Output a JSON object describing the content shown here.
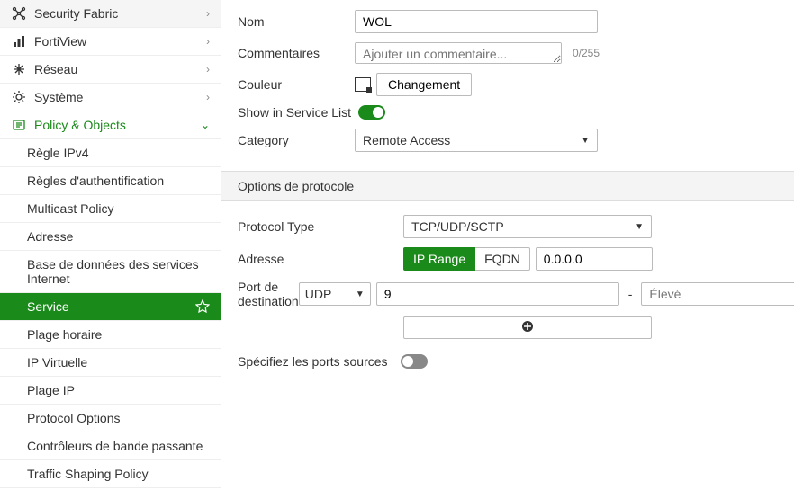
{
  "sidebar": {
    "items": [
      {
        "label": "Security Fabric",
        "icon": "fabric",
        "expanded": false
      },
      {
        "label": "FortiView",
        "icon": "chart",
        "expanded": false
      },
      {
        "label": "Réseau",
        "icon": "network",
        "expanded": false
      },
      {
        "label": "Système",
        "icon": "gear",
        "expanded": false
      },
      {
        "label": "Policy & Objects",
        "icon": "policy",
        "expanded": true,
        "active": true
      }
    ],
    "sub_items": [
      "Règle IPv4",
      "Règles d'authentification",
      "Multicast Policy",
      "Adresse",
      "Base de données des services Internet",
      "Service",
      "Plage horaire",
      "IP Virtuelle",
      "Plage IP",
      "Protocol Options",
      "Contrôleurs de bande passante",
      "Traffic Shaping Policy"
    ],
    "selected_sub": "Service"
  },
  "form": {
    "labels": {
      "nom": "Nom",
      "commentaires": "Commentaires",
      "couleur": "Couleur",
      "show_in_list": "Show in Service List",
      "category": "Category",
      "section": "Options de protocole",
      "protocol_type": "Protocol Type",
      "adresse": "Adresse",
      "port_dest": "Port de destination",
      "specify_src": "Spécifiez les ports sources"
    },
    "nom_value": "WOL",
    "commentaires_placeholder": "Ajouter un commentaire...",
    "commentaires_counter": "0/255",
    "changement": "Changement",
    "show_in_list_on": true,
    "category_value": "Remote Access",
    "protocol_type_value": "TCP/UDP/SCTP",
    "address_modes": {
      "ip_range": "IP Range",
      "fqdn": "FQDN"
    },
    "address_value": "0.0.0.0",
    "port_proto": "UDP",
    "port_low": "9",
    "port_high_placeholder": "Élevé",
    "specify_src_on": false
  }
}
